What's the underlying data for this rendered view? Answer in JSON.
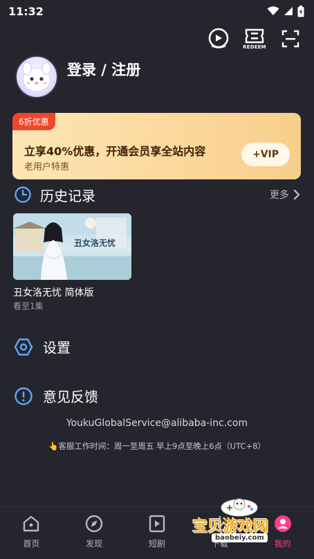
{
  "status_bar": {
    "time": "11:32"
  },
  "top_actions": {
    "redeem_label": "REDEEM"
  },
  "profile": {
    "login_label": "登录 / 注册"
  },
  "vip_banner": {
    "badge": "6折优惠",
    "title": "立享40%优惠，开通会员享全站内容",
    "subtitle": "老用户特惠",
    "button_label": "+VIP"
  },
  "history": {
    "title": "历史记录",
    "more_label": "更多",
    "items": [
      {
        "thumb_text": "丑女洛无忧",
        "title": "丑女洛无忧 简体版",
        "progress": "看至1集"
      }
    ]
  },
  "menu": {
    "settings_label": "设置",
    "feedback_label": "意见反馈"
  },
  "contact": {
    "email": "YoukuGlobalService@alibaba-inc.com",
    "hours_icon": "👆",
    "hours": "客服工作时间：周一至周五 早上9点至晚上6点（UTC+8）"
  },
  "tabbar": {
    "items": [
      {
        "label": "首页",
        "icon": "home-icon"
      },
      {
        "label": "发现",
        "icon": "compass-icon"
      },
      {
        "label": "短剧",
        "icon": "play-square-icon"
      },
      {
        "label": "下载",
        "icon": "download-icon"
      },
      {
        "label": "我的",
        "icon": "profile-icon"
      }
    ],
    "active_index": 4
  },
  "watermark": {
    "text": "宝贝游戏网",
    "url": "baobeiy.com"
  },
  "colors": {
    "background": "#25252d",
    "vip_gradient_start": "#fde6b5",
    "vip_badge": "#f0462b",
    "accent_blue": "#5da8ff",
    "active_tab": "#ff3d8c"
  }
}
